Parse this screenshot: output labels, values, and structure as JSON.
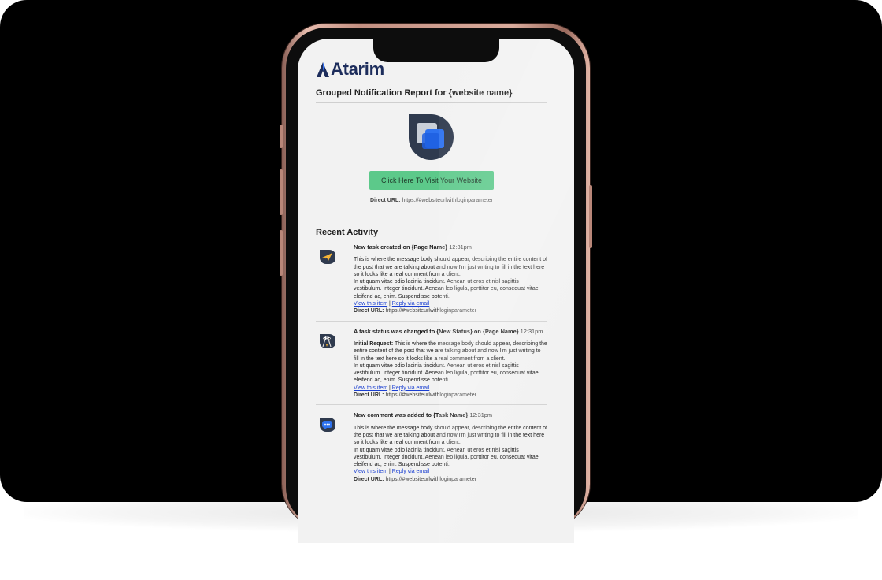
{
  "brand": {
    "logo_text": "Atarim",
    "logo_color": "#1d2d5c"
  },
  "email": {
    "title": "Grouped Notification Report for {website name}",
    "visit_button": "Click Here To Visit Your Website",
    "direct_url_label": "Direct URL:",
    "direct_url_value": "https://#websiteurlwithloginparameter",
    "recent_activity": "Recent Activity"
  },
  "activity": [
    {
      "icon": "paper-plane-icon",
      "heading": "New task created on {Page Name}",
      "time": "12:31pm",
      "prefix": "",
      "body": "This is where the message body should appear, describing the entire content of the post that we are talking about and now I'm just writing to fill in the text here so it looks like a real comment from a client.",
      "body2": "In ut quam vitae odio lacinia tincidunt. Aenean ut eros et nisl sagittis vestibulum. Integer tincidunt. Aenean leo ligula, porttitor eu, consequat vitae, eleifend ac, enim. Suspendisse potenti.",
      "view_link": "View this item",
      "separator": "|",
      "reply_link": "Reply via email",
      "direct_label": "Direct URL:",
      "direct_value": "https://#websiteurlwithloginparameter"
    },
    {
      "icon": "finish-flags-icon",
      "heading": "A task status was changed to {New Status} on {Page Name}",
      "time": "12:31pm",
      "prefix": "Initial Request:",
      "body": "This is where the message body should appear, describing the entire content of the post that we are talking about and now I'm just writing to fill in the text here so it looks like a real comment from a client.",
      "body2": "In ut quam vitae odio lacinia tincidunt. Aenean ut eros et nisl sagittis vestibulum. Integer tincidunt. Aenean leo ligula, porttitor eu, consequat vitae, eleifend ac, enim. Suspendisse potenti.",
      "view_link": "View this item",
      "separator": "|",
      "reply_link": "Reply via email",
      "direct_label": "Direct URL:",
      "direct_value": "https://#websiteurlwithloginparameter"
    },
    {
      "icon": "comment-bubble-icon",
      "heading": "New comment was added to {Task Name}",
      "time": "12:31pm",
      "prefix": "",
      "body": "This is where the message body should appear, describing the entire content of the post that we are talking about and now I'm just writing to fill in the text here so it looks like a real comment from a client.",
      "body2": "In ut quam vitae odio lacinia tincidunt. Aenean ut eros et nisl sagittis vestibulum. Integer tincidunt. Aenean leo ligula, porttitor eu, consequat vitae, eleifend ac, enim. Suspendisse potenti.",
      "view_link": "View this item",
      "separator": "|",
      "reply_link": "Reply via email",
      "direct_label": "Direct URL:",
      "direct_value": "https://#websiteurlwithloginparameter"
    }
  ],
  "colors": {
    "button": "#5cc98a",
    "link": "#1a3fd1",
    "backdrop": "#000000"
  }
}
